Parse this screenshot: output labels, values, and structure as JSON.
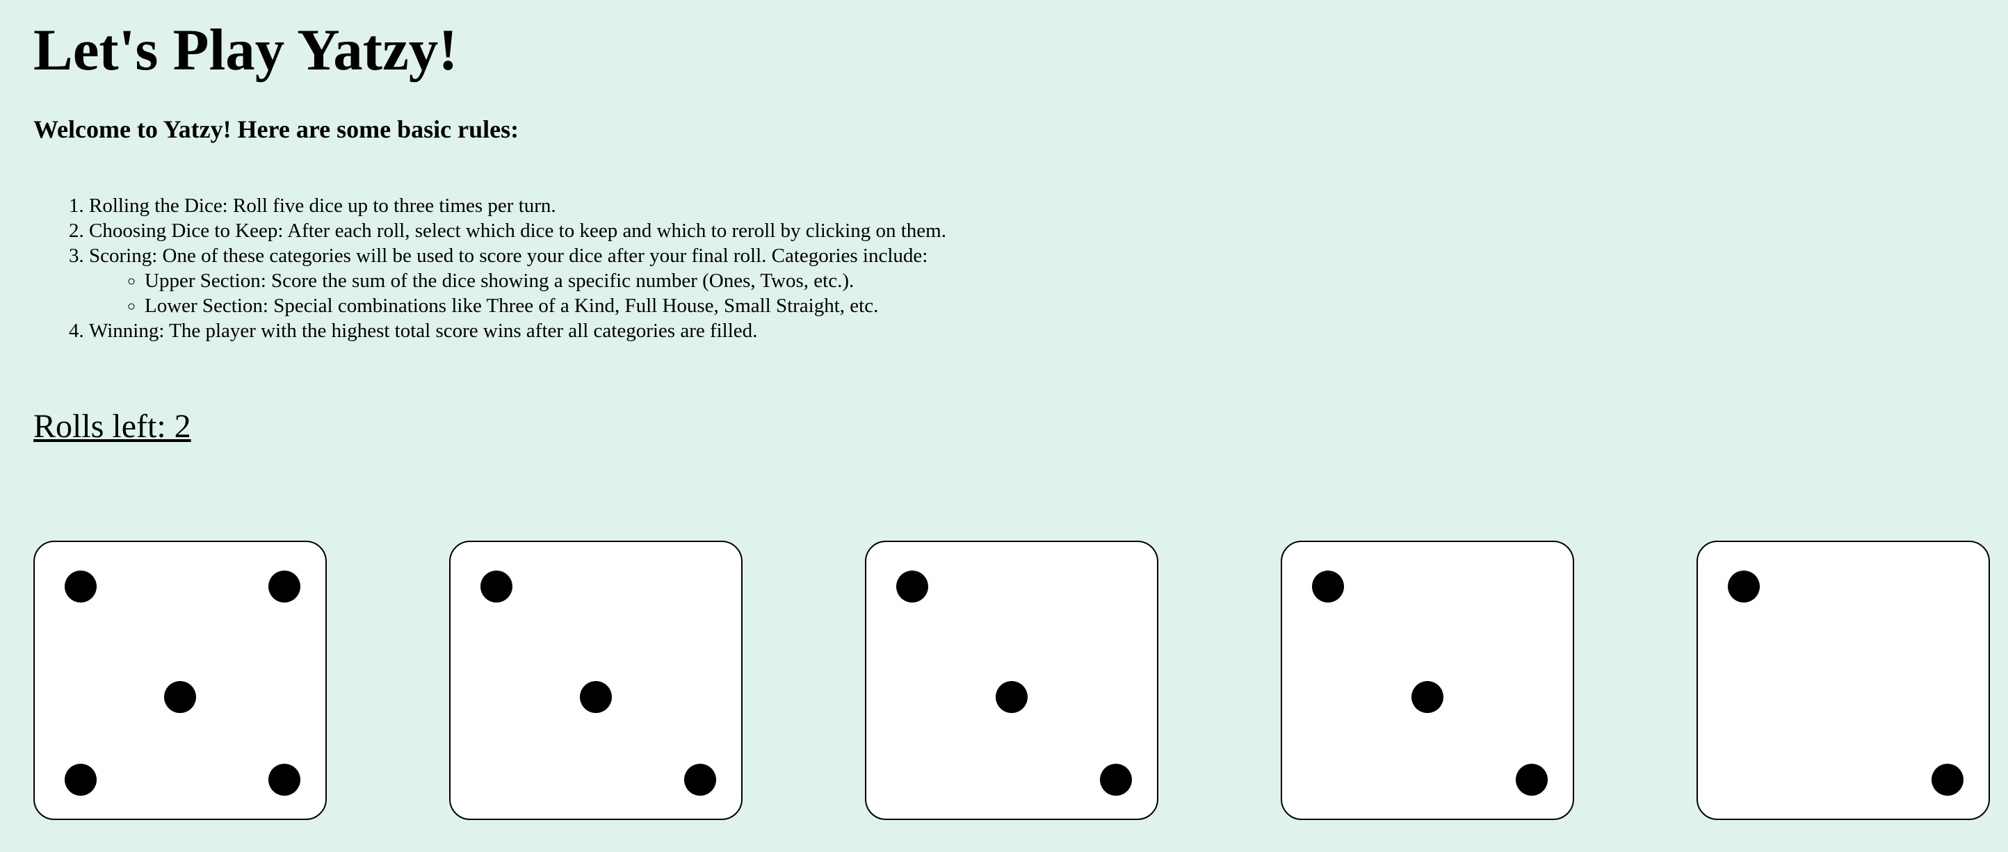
{
  "title": "Let's Play Yatzy!",
  "intro": "Welcome to Yatzy! Here are some basic rules:",
  "rules": [
    {
      "text": "Rolling the Dice: Roll five dice up to three times per turn."
    },
    {
      "text": "Choosing Dice to Keep: After each roll, select which dice to keep and which to reroll by clicking on them."
    },
    {
      "text": "Scoring: One of these categories will be used to score your dice after your final roll. Categories include:",
      "sub": [
        "Upper Section: Score the sum of the dice showing a specific number (Ones, Twos, etc.).",
        "Lower Section: Special combinations like Three of a Kind, Full House, Small Straight, etc."
      ]
    },
    {
      "text": "Winning: The player with the highest total score wins after all categories are filled."
    }
  ],
  "rolls_left_label": "Rolls left: 2",
  "dice": [
    5,
    3,
    3,
    3,
    2
  ],
  "colors": {
    "background": "#dff3ea",
    "die_face": "#ffffff",
    "pip": "#000000"
  }
}
